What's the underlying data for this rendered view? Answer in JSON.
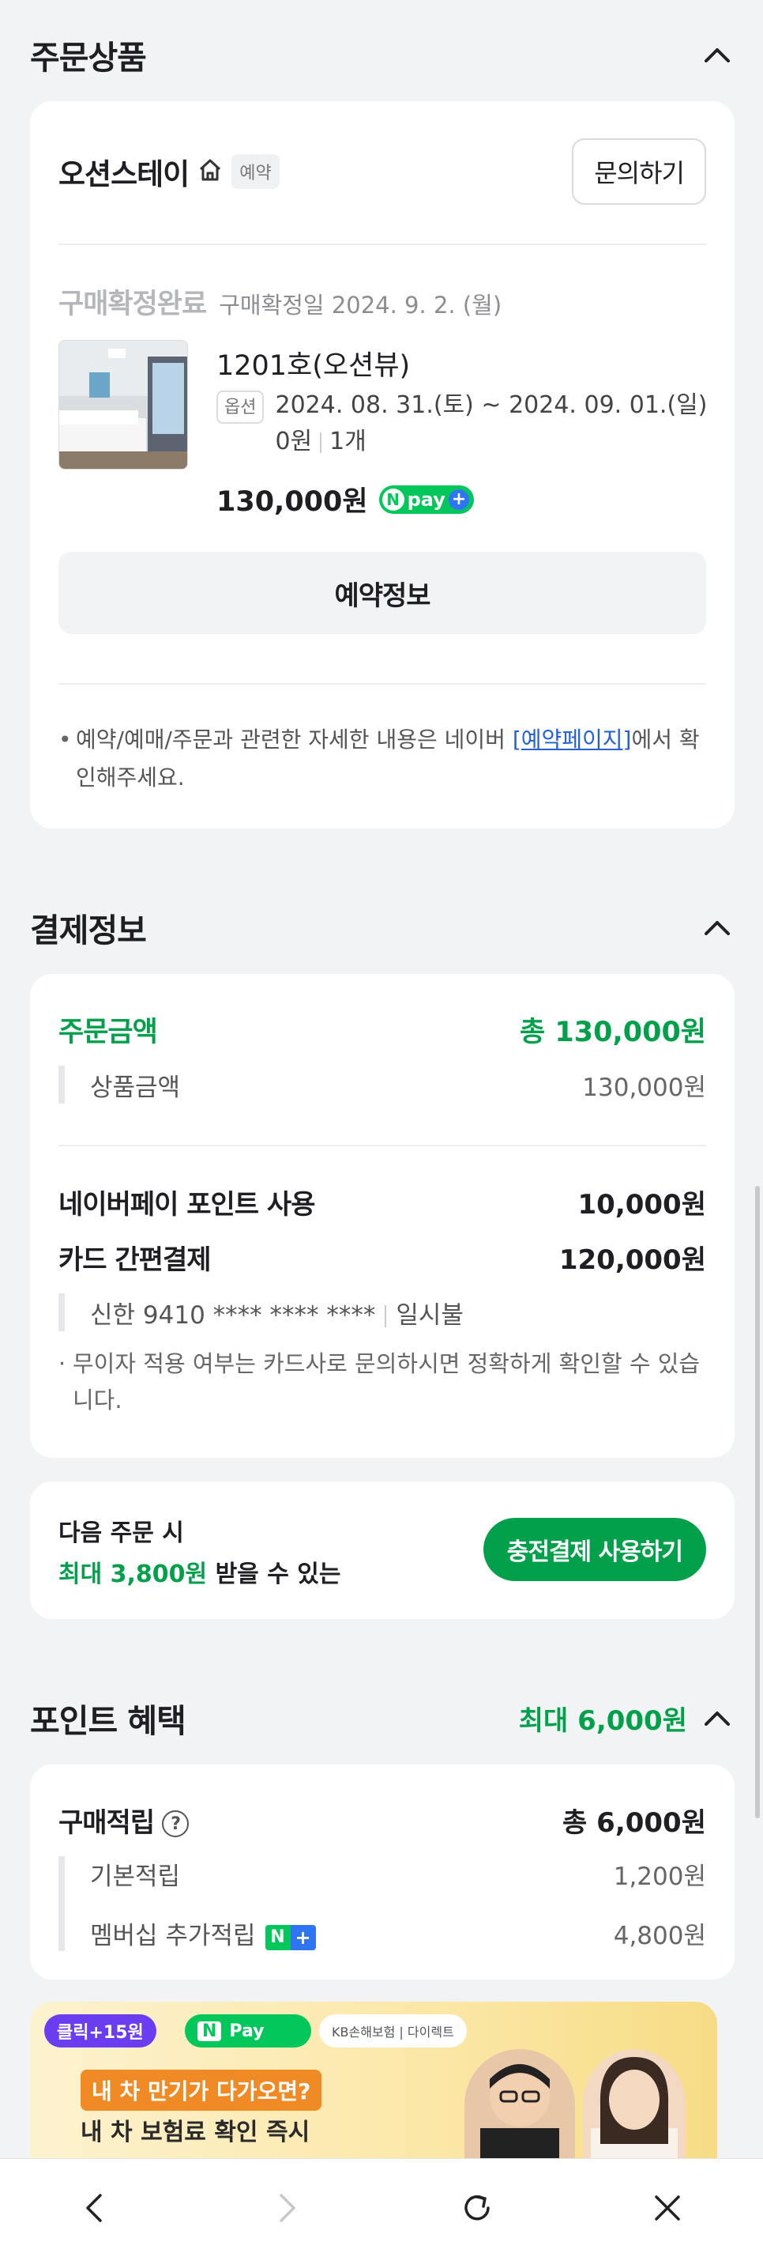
{
  "colors": {
    "accent_green": "#03a04c",
    "npay_green": "#03c75a",
    "link_blue": "#2461d8",
    "background": "#f2f3f5"
  },
  "order_section": {
    "title": "주문상품",
    "store_name": "오션스테이",
    "store_tag": "예약",
    "inquiry_button": "문의하기",
    "status": "구매확정완료",
    "status_date": "구매확정일 2024. 9. 2. (월)",
    "room_name": "1201호(오션뷰)",
    "option_tag": "옵션",
    "option_text": "2024. 08. 31.(토) ~ 2024. 09. 01.(일) 0원",
    "option_qty": "1개",
    "price": "130,000원",
    "npay_badge": "pay",
    "reservation_button": "예약정보",
    "notice_before": "예약/예매/주문과 관련한 자세한 내용은 네이버 ",
    "notice_link": "[예약페이지]",
    "notice_after": "에서 확인해주세요."
  },
  "payment_section": {
    "title": "결제정보",
    "order_amount_label": "주문금액",
    "order_amount_value": "총 130,000원",
    "product_amount_label": "상품금액",
    "product_amount_value": "130,000원",
    "npay_point_label": "네이버페이 포인트 사용",
    "npay_point_value": "10,000원",
    "card_pay_label": "카드 간편결제",
    "card_pay_value": "120,000원",
    "card_info": "신한 9410 **** **** ****",
    "installment": "일시불",
    "card_note": "무이자 적용 여부는 카드사로 문의하시면 정확하게 확인할 수 있습니다."
  },
  "promo": {
    "line1": "다음 주문 시",
    "line2_green": "최대 3,800원",
    "line2_rest": " 받을 수 있는",
    "button": "충전결제 사용하기"
  },
  "points_section": {
    "title": "포인트 혜택",
    "max_label": "최대 6,000원",
    "purchase_label": "구매적립",
    "purchase_total": "총 6,000원",
    "basic_label": "기본적립",
    "basic_value": "1,200원",
    "member_label": "멤버십 추가적립",
    "member_value": "4,800원",
    "nplus_n": "N",
    "nplus_plus": "+"
  },
  "ad": {
    "click_reward": "클릭+15원",
    "npay_label": "Pay",
    "insurer": "KB손해보험 | 다이렉트",
    "headline1": "내 차 만기가 다가오면?",
    "headline2": "내 차 보험료 확인 즉시"
  },
  "nav": {
    "back": "back-icon",
    "forward": "forward-icon",
    "refresh": "refresh-icon",
    "close": "close-icon"
  }
}
